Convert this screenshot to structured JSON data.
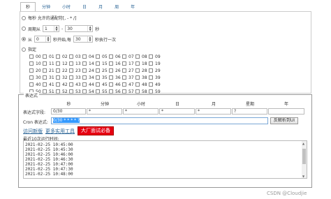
{
  "tabs": [
    "秒",
    "分钟",
    "小时",
    "日",
    "月",
    "周",
    "年"
  ],
  "second": {
    "opt1": "每秒 允许的通配符[, - * /]",
    "opt2_pre": "周期从",
    "opt2_from": "1",
    "opt2_dash": "-",
    "opt2_to": "30",
    "opt2_unit": "秒",
    "opt3_pre": "从",
    "opt3_from": "0",
    "opt3_mid": "秒开始,每",
    "opt3_every": "30",
    "opt3_post": "秒执行一次",
    "opt4": "指定",
    "values": [
      "00",
      "01",
      "02",
      "03",
      "04",
      "05",
      "06",
      "07",
      "08",
      "09",
      "10",
      "11",
      "12",
      "13",
      "14",
      "15",
      "16",
      "17",
      "18",
      "19",
      "20",
      "21",
      "22",
      "23",
      "24",
      "25",
      "26",
      "27",
      "28",
      "29",
      "30",
      "31",
      "32",
      "33",
      "34",
      "35",
      "36",
      "37",
      "38",
      "39",
      "40",
      "41",
      "42",
      "43",
      "44",
      "45",
      "46",
      "47",
      "48",
      "49",
      "50",
      "51",
      "52",
      "53",
      "54",
      "55",
      "56",
      "57",
      "58",
      "59"
    ]
  },
  "expression": {
    "legend": "表达式",
    "headers": [
      "秒",
      "分钟",
      "小时",
      "日",
      "月",
      "星期",
      "年"
    ],
    "field_label": "表达式字段:",
    "fields": [
      "0/30",
      "*",
      "*",
      "*",
      "*",
      "?",
      ""
    ],
    "cron_label": "Cron 表达式:",
    "cron_value": "0/30 * * * * ?",
    "parse_button": "反解析到UI"
  },
  "links": {
    "new_version": "访问新版",
    "more_tools": "更多实用工具",
    "red_button": "大厂面试必备"
  },
  "results": {
    "label": "最近10次运行时间:",
    "times": [
      "2021-02-25 10:45:00",
      "2021-02-25 10:45:30",
      "2021-02-25 10:46:00",
      "2021-02-25 10:46:30",
      "2021-02-25 10:47:00",
      "2021-02-25 10:47:30",
      "2021-02-25 10:48:00"
    ]
  },
  "watermark": "CSDN @Cloudjie"
}
